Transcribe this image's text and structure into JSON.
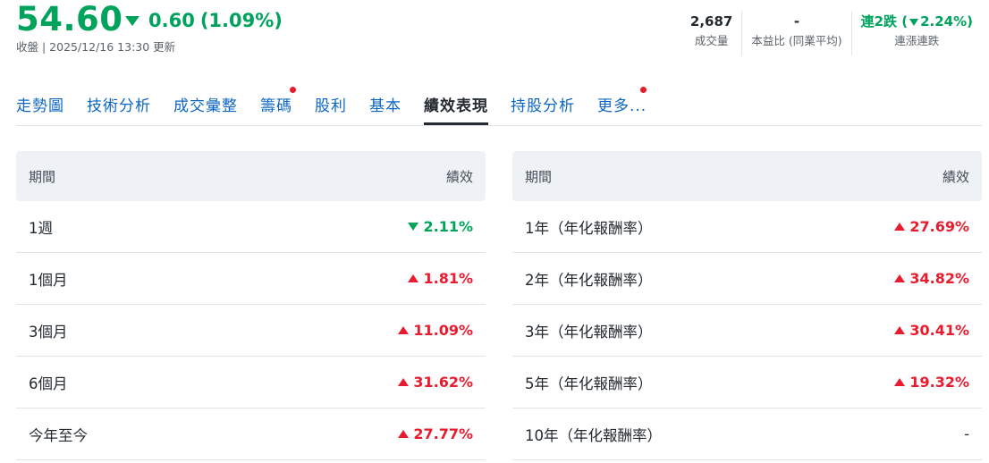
{
  "quote": {
    "price": "54.60",
    "change": "0.60",
    "change_pct": "(1.09%)",
    "close_label": "收盤 | 2025/12/16 13:30 更新"
  },
  "stats": [
    {
      "value": "2,687",
      "label": "成交量"
    },
    {
      "value": "-",
      "label": "本益比 (同業平均)"
    },
    {
      "value_prefix": "連2跌 (",
      "value_pct": "2.24%)",
      "label": "連漲連跌"
    }
  ],
  "tabs": [
    {
      "label": "走勢圖",
      "dot": false
    },
    {
      "label": "技術分析",
      "dot": false
    },
    {
      "label": "成交彙整",
      "dot": false
    },
    {
      "label": "籌碼",
      "dot": true
    },
    {
      "label": "股利",
      "dot": false
    },
    {
      "label": "基本",
      "dot": false
    },
    {
      "label": "績效表現",
      "dot": false,
      "active": true
    },
    {
      "label": "持股分析",
      "dot": false
    },
    {
      "label": "更多...",
      "dot": true
    }
  ],
  "colors": {
    "up": "#e81c2e",
    "down": "#00a35c",
    "link": "#0d66c2"
  },
  "table_left": {
    "col_period": "期間",
    "col_perf": "績效",
    "rows": [
      {
        "period": "1週",
        "value": "2.11%",
        "dir": "down"
      },
      {
        "period": "1個月",
        "value": "1.81%",
        "dir": "up"
      },
      {
        "period": "3個月",
        "value": "11.09%",
        "dir": "up"
      },
      {
        "period": "6個月",
        "value": "31.62%",
        "dir": "up"
      },
      {
        "period": "今年至今",
        "value": "27.77%",
        "dir": "up"
      }
    ]
  },
  "table_right": {
    "col_period": "期間",
    "col_perf": "績效",
    "rows": [
      {
        "period": "1年（年化報酬率）",
        "value": "27.69%",
        "dir": "up"
      },
      {
        "period": "2年（年化報酬率）",
        "value": "34.82%",
        "dir": "up"
      },
      {
        "period": "3年（年化報酬率）",
        "value": "30.41%",
        "dir": "up"
      },
      {
        "period": "5年（年化報酬率）",
        "value": "19.32%",
        "dir": "up"
      },
      {
        "period": "10年（年化報酬率）",
        "value": "-",
        "dir": "none"
      }
    ]
  }
}
